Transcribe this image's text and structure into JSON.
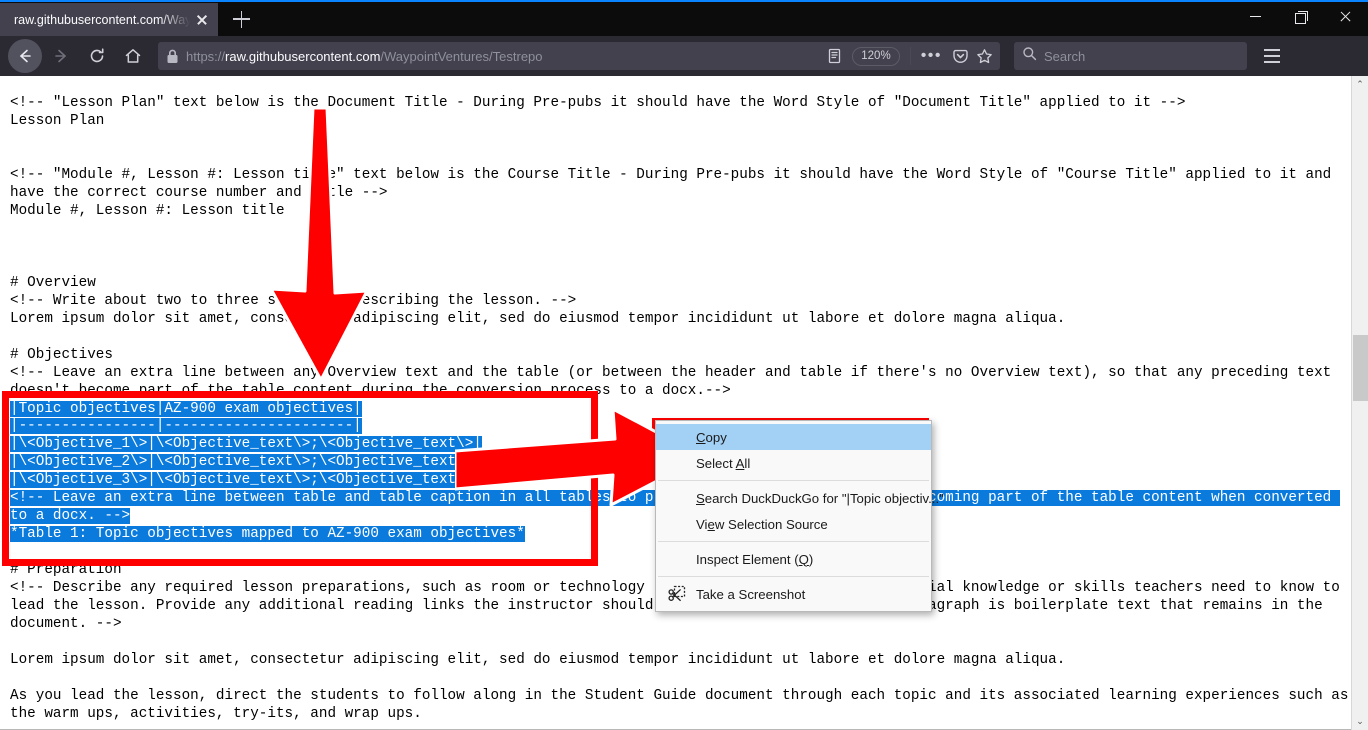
{
  "browser": {
    "accent_color": "#0a84ff",
    "tab": {
      "title": "raw.githubusercontent.com/Waypo",
      "close_label": "Close tab"
    },
    "new_tab_label": "New Tab",
    "window_controls": {
      "minimize": "Minimize",
      "restore": "Restore Down",
      "close": "Close"
    },
    "nav": {
      "back": "Back",
      "forward": "Forward",
      "reload": "Reload",
      "home": "Home"
    },
    "url": {
      "scheme": "https://",
      "host": "raw.githubusercontent.com",
      "path": "/WaypointVentures/Testrepo",
      "full": "https://raw.githubusercontent.com/WaypointVentures/Testrepo"
    },
    "zoom_level": "120%",
    "reader_label": "Reader View",
    "more_label": "•••",
    "pocket_label": "Save to Pocket",
    "bookmark_label": "Bookmark this page",
    "search": {
      "placeholder": "Search",
      "value": ""
    },
    "menu_label": "Open application menu"
  },
  "page": {
    "lines": [
      {
        "text": "<!-- \"Lesson Plan\" text below is the Document Title - During Pre-pubs it should have the Word Style of \"Document Title\" applied to it -->",
        "selected": false
      },
      {
        "text": "Lesson Plan",
        "selected": false
      },
      {
        "text": "",
        "selected": false
      },
      {
        "text": "",
        "selected": false
      },
      {
        "text": "<!-- \"Module #, Lesson #: Lesson title\" text below is the Course Title - During Pre-pubs it should have the Word Style of \"Course Title\" applied to it and have the correct course number and title -->",
        "selected": false
      },
      {
        "text": "Module #, Lesson #: Lesson title",
        "selected": false
      },
      {
        "text": "",
        "selected": false
      },
      {
        "text": "",
        "selected": false
      },
      {
        "text": "",
        "selected": false
      },
      {
        "text": "# Overview",
        "selected": false
      },
      {
        "text": "<!-- Write about two to three sentences describing the lesson. -->",
        "selected": false
      },
      {
        "text": "Lorem ipsum dolor sit amet, consectetur adipiscing elit, sed do eiusmod tempor incididunt ut labore et dolore magna aliqua.",
        "selected": false
      },
      {
        "text": "",
        "selected": false
      },
      {
        "text": "# Objectives",
        "selected": false
      },
      {
        "text": "<!-- Leave an extra line between any Overview text and the table (or between the header and table if there's no Overview text), so that any preceding text doesn't become part of the table content during the conversion process to a docx.-->",
        "selected": false
      },
      {
        "text": "|Topic objectives|AZ-900 exam objectives|",
        "selected": true
      },
      {
        "text": "|----------------|----------------------|",
        "selected": true
      },
      {
        "text": "|\\<Objective_1\\>|\\<Objective_text\\>;\\<Objective_text\\>|",
        "selected": true
      },
      {
        "text": "|\\<Objective_2\\>|\\<Objective_text\\>;\\<Objective_text\\>|",
        "selected": true
      },
      {
        "text": "|\\<Objective_3\\>|\\<Objective_text\\>;\\<Objective_text\\>|",
        "selected": true
      },
      {
        "text": "<!-- Leave an extra line between table and table caption in all tables to prevent the table caption from becoming part of the table content when converted to a docx. -->",
        "selected": true
      },
      {
        "text": "*Table 1: Topic objectives mapped to AZ-900 exam objectives*",
        "selected": true
      },
      {
        "text": "",
        "selected": false
      },
      {
        "text": "# Preparation",
        "selected": false
      },
      {
        "text": "<!-- Describe any required lesson preparations, such as room or technology requirements. Highlight any crucial knowledge or skills teachers need to know to lead the lesson. Provide any additional reading links the instructor should review to prepare. The last paragraph is boilerplate text that remains in the document. -->",
        "selected": false
      },
      {
        "text": "",
        "selected": false
      },
      {
        "text": "Lorem ipsum dolor sit amet, consectetur adipiscing elit, sed do eiusmod tempor incididunt ut labore et dolore magna aliqua.",
        "selected": false
      },
      {
        "text": "",
        "selected": false
      },
      {
        "text": "As you lead the lesson, direct the students to follow along in the Student Guide document through each topic and its associated learning experiences such as the warm ups, activities, try-its, and wrap ups.",
        "selected": false
      }
    ],
    "selection_color": "#0a7bdd"
  },
  "context_menu": {
    "items": [
      {
        "label": "Copy",
        "accel": "C",
        "highlighted": true,
        "separator_after": false,
        "icon": ""
      },
      {
        "label": "Select All",
        "accel": "A",
        "highlighted": false,
        "separator_after": true,
        "icon": ""
      },
      {
        "label": "Search DuckDuckGo for \"|Topic objectiv...\"",
        "accel": "S",
        "highlighted": false,
        "separator_after": false,
        "icon": ""
      },
      {
        "label": "View Selection Source",
        "accel": "e",
        "highlighted": false,
        "separator_after": true,
        "icon": ""
      },
      {
        "label": "Inspect Element (Q)",
        "accel": "Q",
        "highlighted": false,
        "separator_after": true,
        "icon": ""
      },
      {
        "label": "Take a Screenshot",
        "accel": "",
        "highlighted": false,
        "separator_after": false,
        "icon": "screenshot-icon"
      }
    ]
  },
  "annotations": {
    "color": "#fe0000",
    "arrow_down_label": "arrow pointing down at Objectives table",
    "arrow_right_label": "arrow pointing right at Copy menu item",
    "box_table_label": "red highlight box around selected table markdown",
    "box_copy_label": "red highlight box around Copy menu item"
  },
  "scrollbar": {
    "up_arrow": "⌃",
    "down_arrow": "⌄"
  }
}
